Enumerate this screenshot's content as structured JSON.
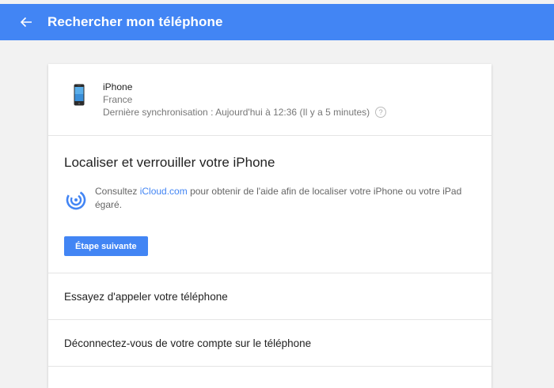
{
  "header": {
    "title": "Rechercher mon téléphone",
    "back_icon": "arrow-left-icon"
  },
  "device": {
    "name": "iPhone",
    "country": "France",
    "last_sync": "Dernière synchronisation : Aujourd'hui à 12:36 (Il y a 5 minutes)",
    "help_glyph": "?"
  },
  "locate": {
    "title": "Localiser et verrouiller votre iPhone",
    "text_before": "Consultez ",
    "link_text": "iCloud.com",
    "text_after": " pour obtenir de l'aide afin de localiser votre iPhone ou votre iPad égaré.",
    "button_label": "Étape suivante"
  },
  "options": [
    "Essayez d'appeler votre téléphone",
    "Déconnectez-vous de votre compte sur le téléphone"
  ],
  "colors": {
    "accent": "#4285f4",
    "background": "#f2f2f2"
  }
}
